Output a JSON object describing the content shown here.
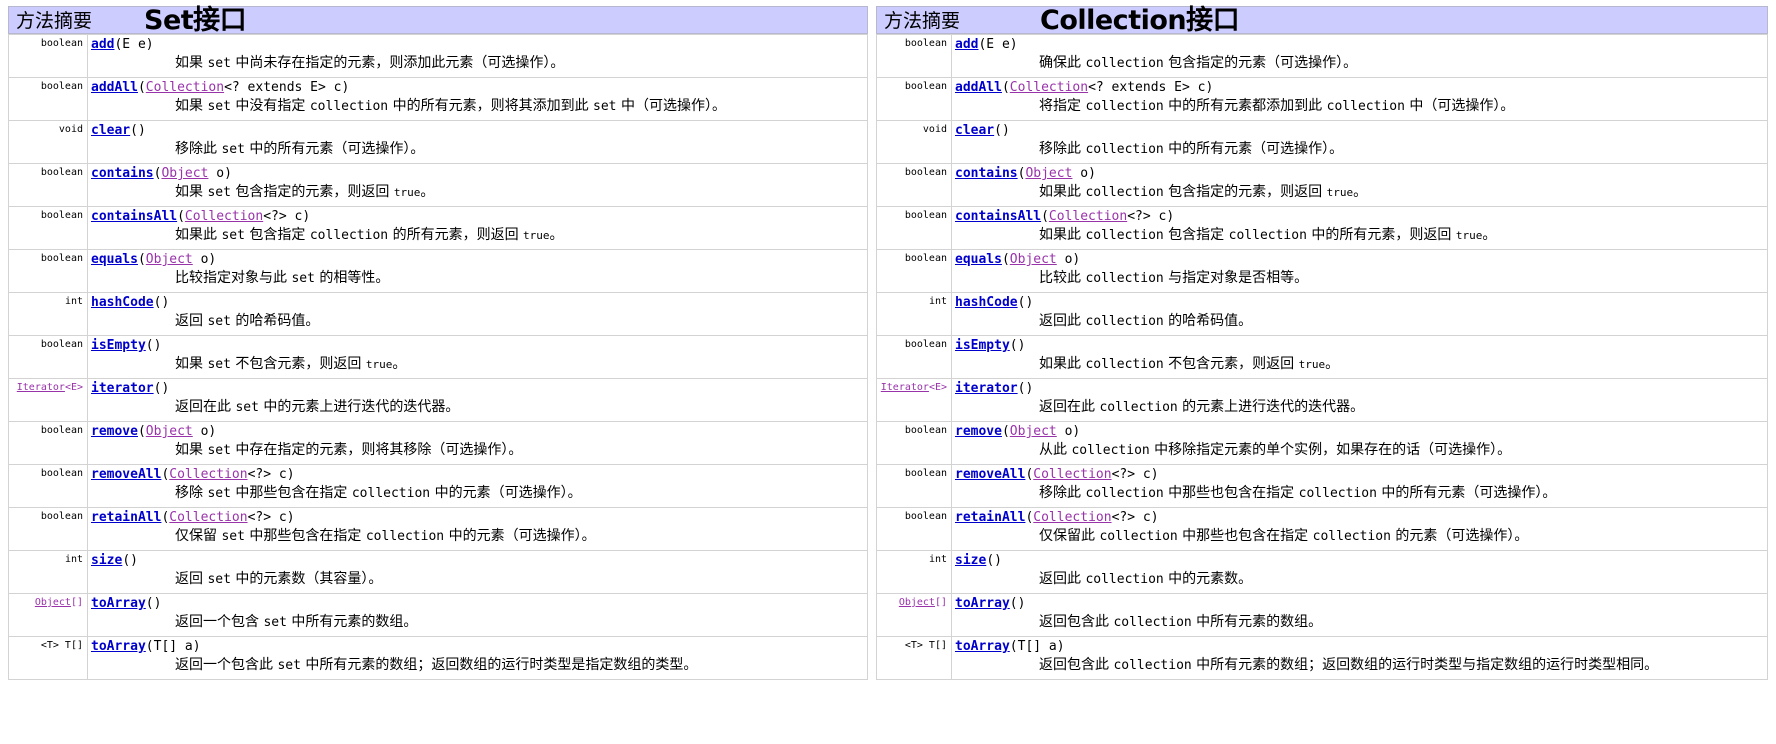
{
  "panels": [
    {
      "id": "set",
      "header_label": "方法摘要",
      "big_title": "Set接口",
      "subject": "set",
      "rows": [
        {
          "return_type": "boolean",
          "name": "add",
          "param_type": "",
          "param_generic": "",
          "signature_tail": "(E e)",
          "description": "如果 set 中尚未存在指定的元素，则添加此元素（可选操作）。"
        },
        {
          "return_type": "boolean",
          "name": "addAll",
          "param_type": "Collection",
          "param_generic": "<? extends E> c)",
          "signature_tail": "",
          "description": "如果 set 中没有指定 collection 中的所有元素，则将其添加到此 set 中（可选操作）。"
        },
        {
          "return_type": "void",
          "name": "clear",
          "param_type": "",
          "param_generic": "",
          "signature_tail": "()",
          "description": "移除此 set 中的所有元素（可选操作）。"
        },
        {
          "return_type": "boolean",
          "name": "contains",
          "param_type": "Object",
          "param_generic": " o)",
          "signature_tail": "",
          "description": "如果 set 包含指定的元素，则返回 true。"
        },
        {
          "return_type": "boolean",
          "name": "containsAll",
          "param_type": "Collection",
          "param_generic": "<?> c)",
          "signature_tail": "",
          "description": "如果此 set 包含指定 collection 的所有元素，则返回 true。"
        },
        {
          "return_type": "boolean",
          "name": "equals",
          "param_type": "Object",
          "param_generic": " o)",
          "signature_tail": "",
          "description": "比较指定对象与此 set 的相等性。"
        },
        {
          "return_type": "int",
          "name": "hashCode",
          "param_type": "",
          "param_generic": "",
          "signature_tail": "()",
          "description": "返回 set 的哈希码值。"
        },
        {
          "return_type": "boolean",
          "name": "isEmpty",
          "param_type": "",
          "param_generic": "",
          "signature_tail": "()",
          "description": "如果 set 不包含元素，则返回 true。"
        },
        {
          "return_type": "Iterator<E>",
          "return_type_link": "Iterator",
          "return_type_generic": "<E>",
          "name": "iterator",
          "param_type": "",
          "param_generic": "",
          "signature_tail": "()",
          "description": "返回在此 set 中的元素上进行迭代的迭代器。"
        },
        {
          "return_type": "boolean",
          "name": "remove",
          "param_type": "Object",
          "param_generic": " o)",
          "signature_tail": "",
          "description": "如果 set 中存在指定的元素，则将其移除（可选操作）。"
        },
        {
          "return_type": "boolean",
          "name": "removeAll",
          "param_type": "Collection",
          "param_generic": "<?> c)",
          "signature_tail": "",
          "description": "移除 set 中那些包含在指定 collection 中的元素（可选操作）。"
        },
        {
          "return_type": "boolean",
          "name": "retainAll",
          "param_type": "Collection",
          "param_generic": "<?> c)",
          "signature_tail": "",
          "description": "仅保留 set 中那些包含在指定 collection 中的元素（可选操作）。"
        },
        {
          "return_type": "int",
          "name": "size",
          "param_type": "",
          "param_generic": "",
          "signature_tail": "()",
          "description": "返回 set 中的元素数（其容量）。"
        },
        {
          "return_type": "Object[]",
          "return_type_link": "Object",
          "return_type_generic": "[]",
          "name": "toArray",
          "param_type": "",
          "param_generic": "",
          "signature_tail": "()",
          "description": "返回一个包含 set 中所有元素的数组。"
        },
        {
          "return_type": "<T> T[]",
          "return_type_link": "",
          "return_type_generic": "",
          "name": "toArray",
          "param_type": "",
          "param_generic": "",
          "signature_tail": "(T[] a)",
          "description": "返回一个包含此 set 中所有元素的数组；返回数组的运行时类型是指定数组的类型。"
        }
      ]
    },
    {
      "id": "collection",
      "header_label": "方法摘要",
      "big_title": "Collection接口",
      "subject": "collection",
      "rows": [
        {
          "return_type": "boolean",
          "name": "add",
          "param_type": "",
          "param_generic": "",
          "signature_tail": "(E e)",
          "description": "确保此 collection 包含指定的元素（可选操作）。"
        },
        {
          "return_type": "boolean",
          "name": "addAll",
          "param_type": "Collection",
          "param_generic": "<? extends E> c)",
          "signature_tail": "",
          "description": "将指定 collection 中的所有元素都添加到此 collection 中（可选操作）。"
        },
        {
          "return_type": "void",
          "name": "clear",
          "param_type": "",
          "param_generic": "",
          "signature_tail": "()",
          "description": "移除此 collection 中的所有元素（可选操作）。"
        },
        {
          "return_type": "boolean",
          "name": "contains",
          "param_type": "Object",
          "param_generic": " o)",
          "signature_tail": "",
          "description": "如果此 collection 包含指定的元素，则返回 true。"
        },
        {
          "return_type": "boolean",
          "name": "containsAll",
          "param_type": "Collection",
          "param_generic": "<?> c)",
          "signature_tail": "",
          "description": "如果此 collection 包含指定 collection 中的所有元素，则返回 true。"
        },
        {
          "return_type": "boolean",
          "name": "equals",
          "param_type": "Object",
          "param_generic": " o)",
          "signature_tail": "",
          "description": "比较此 collection 与指定对象是否相等。"
        },
        {
          "return_type": "int",
          "name": "hashCode",
          "param_type": "",
          "param_generic": "",
          "signature_tail": "()",
          "description": "返回此 collection 的哈希码值。"
        },
        {
          "return_type": "boolean",
          "name": "isEmpty",
          "param_type": "",
          "param_generic": "",
          "signature_tail": "()",
          "description": "如果此 collection 不包含元素，则返回 true。"
        },
        {
          "return_type": "Iterator<E>",
          "return_type_link": "Iterator",
          "return_type_generic": "<E>",
          "name": "iterator",
          "param_type": "",
          "param_generic": "",
          "signature_tail": "()",
          "description": "返回在此 collection 的元素上进行迭代的迭代器。"
        },
        {
          "return_type": "boolean",
          "name": "remove",
          "param_type": "Object",
          "param_generic": " o)",
          "signature_tail": "",
          "description": "从此 collection 中移除指定元素的单个实例，如果存在的话（可选操作）。"
        },
        {
          "return_type": "boolean",
          "name": "removeAll",
          "param_type": "Collection",
          "param_generic": "<?> c)",
          "signature_tail": "",
          "description": "移除此 collection 中那些也包含在指定 collection 中的所有元素（可选操作）。"
        },
        {
          "return_type": "boolean",
          "name": "retainAll",
          "param_type": "Collection",
          "param_generic": "<?> c)",
          "signature_tail": "",
          "description": "仅保留此 collection 中那些也包含在指定 collection 的元素（可选操作）。"
        },
        {
          "return_type": "int",
          "name": "size",
          "param_type": "",
          "param_generic": "",
          "signature_tail": "()",
          "description": "返回此 collection 中的元素数。"
        },
        {
          "return_type": "Object[]",
          "return_type_link": "Object",
          "return_type_generic": "[]",
          "name": "toArray",
          "param_type": "",
          "param_generic": "",
          "signature_tail": "()",
          "description": "返回包含此 collection 中所有元素的数组。"
        },
        {
          "return_type": "<T> T[]",
          "return_type_link": "",
          "return_type_generic": "",
          "name": "toArray",
          "param_type": "",
          "param_generic": "",
          "signature_tail": "(T[] a)",
          "description": "返回包含此 collection 中所有元素的数组；返回数组的运行时类型与指定数组的运行时类型相同。"
        }
      ]
    }
  ],
  "colors": {
    "header_bg": "#ccccff",
    "method_link": "#0000cc",
    "type_link": "#9933aa",
    "row_border": "#d3d3d3"
  }
}
